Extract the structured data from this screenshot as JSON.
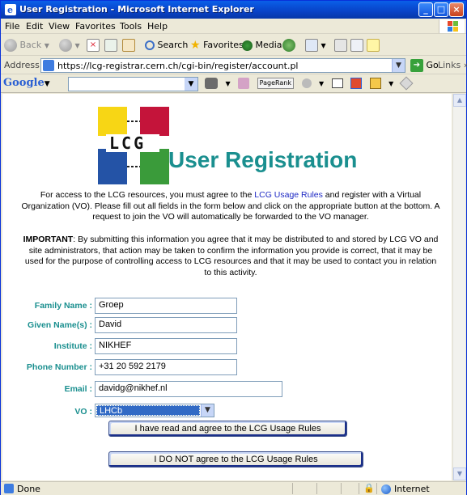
{
  "window": {
    "title": "User Registration - Microsoft Internet Explorer",
    "colors": {
      "titlebar": "#0842c7",
      "accent_teal": "#1a8f8f",
      "link": "#1f2ac4",
      "selection": "#316ac5"
    }
  },
  "menu": {
    "items": [
      "File",
      "Edit",
      "View",
      "Favorites",
      "Tools",
      "Help"
    ]
  },
  "toolbar": {
    "back_label": "Back",
    "search_label": "Search",
    "favorites_label": "Favorites",
    "media_label": "Media"
  },
  "address": {
    "label": "Address",
    "url": "https://lcg-registrar.cern.ch/cgi-bin/register/account.pl",
    "go_label": "Go",
    "links_label": "Links"
  },
  "google": {
    "logo": "Google",
    "pagerank_label": "PageRank"
  },
  "page": {
    "logo_text": "LCG",
    "title": "User Registration",
    "intro_before_link": "For access to the LCG resources, you must agree to the ",
    "intro_link": "LCG Usage Rules",
    "intro_after_link": " and register with a Virtual Organization (VO). Please fill out all fields in the form below and click on the appropriate button at the bottom. A request to join the VO will automatically be forwarded to the VO manager.",
    "important_label": "IMPORTANT",
    "important_text": ": By submitting this information you agree that it may be distributed to and stored by LCG VO and site administrators, that action may be taken to confirm the information you provide is correct, that it may be used for the purpose of controlling access to LCG resources and that it may be used to contact you in relation to this activity."
  },
  "form": {
    "family_name": {
      "label": "Family Name :",
      "value": "Groep"
    },
    "given_names": {
      "label": "Given Name(s) :",
      "value": "David"
    },
    "institute": {
      "label": "Institute :",
      "value": "NIKHEF"
    },
    "phone": {
      "label": "Phone Number :",
      "value": "+31 20 592 2179"
    },
    "email": {
      "label": "Email :",
      "value": "davidg@nikhef.nl"
    },
    "vo": {
      "label": "VO :",
      "value": "LHCb"
    },
    "agree_button": "I have read and agree to the LCG Usage Rules",
    "disagree_button": "I DO NOT agree to the LCG Usage Rules"
  },
  "status": {
    "text": "Done",
    "zone": "Internet"
  }
}
